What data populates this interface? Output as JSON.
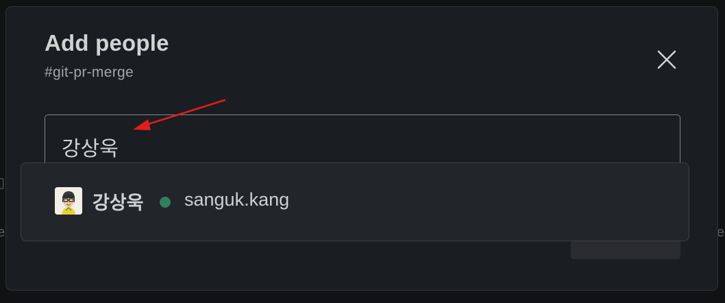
{
  "modal": {
    "title": "Add people",
    "channel": "#git-pr-merge",
    "close_icon": "close-icon"
  },
  "input": {
    "value": "강상욱"
  },
  "suggestions": [
    {
      "name": "강상욱",
      "handle": "sanguk.kang",
      "status": "active",
      "status_color": "#2f8060"
    }
  ],
  "colors": {
    "background": "#1a1d21",
    "annotation_arrow": "#e01e1e"
  }
}
